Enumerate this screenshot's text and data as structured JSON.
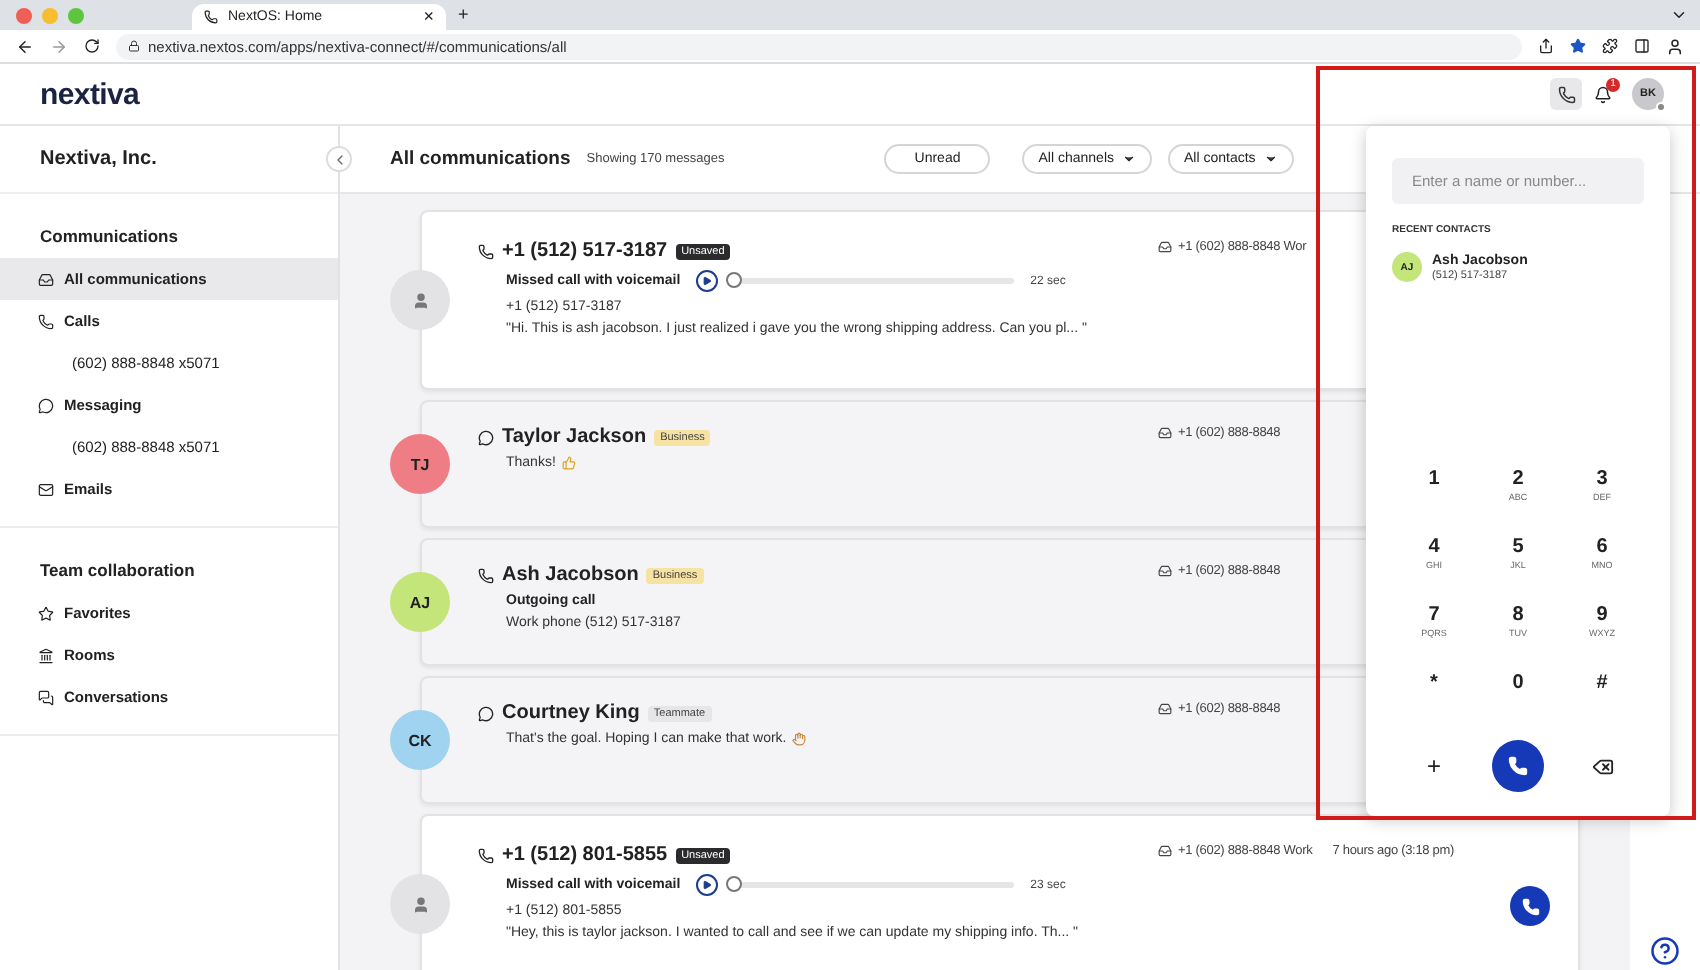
{
  "browser": {
    "tab_title": "NextOS: Home",
    "tab_close": "×",
    "new_tab": "+",
    "url": "nextiva.nextos.com/apps/nextiva-connect/#/communications/all"
  },
  "app_header": {
    "logo": "nextiva",
    "dialer_active": true,
    "notification_count": "1",
    "user_initials": "BK"
  },
  "sidebar": {
    "org": "Nextiva, Inc.",
    "sections": [
      {
        "title": "Communications",
        "items": [
          {
            "label": "All communications",
            "kind": "inbox",
            "selected": true
          },
          {
            "label": "Calls",
            "kind": "phone",
            "selected": false,
            "children": [
              {
                "label": "(602) 888-8848 x5071",
                "selected": false
              }
            ]
          },
          {
            "label": "Messaging",
            "kind": "chat",
            "selected": false,
            "children": [
              {
                "label": "(602) 888-8848 x5071",
                "selected": false
              }
            ]
          },
          {
            "label": "Emails",
            "kind": "mail",
            "selected": false
          }
        ]
      },
      {
        "title": "Team collaboration",
        "items": [
          {
            "label": "Favorites",
            "kind": "star",
            "selected": false
          },
          {
            "label": "Rooms",
            "kind": "building",
            "selected": false
          },
          {
            "label": "Conversations",
            "kind": "chats",
            "selected": false
          }
        ]
      }
    ]
  },
  "main": {
    "title": "All communications",
    "count": "Showing 170 messages",
    "filters": [
      {
        "label": "Unread",
        "kind": "toggle"
      },
      {
        "label": "All channels",
        "kind": "dropdown"
      },
      {
        "label": "All contacts",
        "kind": "dropdown"
      }
    ],
    "cards": [
      {
        "kind": "call",
        "unread": true,
        "avatar": {
          "kind": "unknown"
        },
        "name": "+1 (512) 517-3187",
        "tag": {
          "label": "Unsaved",
          "kind": "dark"
        },
        "summary": "Missed call with voicemail",
        "voicemail": {
          "duration": "22 sec",
          "level": 0
        },
        "lines": [
          {
            "text": "+1 (512) 517-3187"
          },
          {
            "text": "\"Hi. This is ash jacobson. I just realized i gave you the wrong shipping address. Can you pl... \""
          }
        ],
        "line_info": "+1 (602) 888-8848 Wor"
      },
      {
        "kind": "message",
        "unread": false,
        "avatar": {
          "kind": "initials",
          "initials": "TJ",
          "color": "#ef7d86"
        },
        "name": "Taylor Jackson",
        "tag": {
          "label": "Business",
          "kind": "yellow"
        },
        "lines": [
          {
            "text": "Thanks!",
            "emoji": true
          }
        ],
        "line_info": "+1 (602) 888-8848"
      },
      {
        "kind": "call",
        "unread": false,
        "avatar": {
          "kind": "initials",
          "initials": "AJ",
          "color": "#c3e57a"
        },
        "name": "Ash Jacobson",
        "tag": {
          "label": "Business",
          "kind": "yellow"
        },
        "summary": "Outgoing call",
        "lines": [
          {
            "text": "Work phone (512) 517-3187"
          }
        ],
        "line_info": "+1 (602) 888-8848"
      },
      {
        "kind": "message",
        "unread": false,
        "avatar": {
          "kind": "initials",
          "initials": "CK",
          "color": "#9fd3ef"
        },
        "name": "Courtney King",
        "tag": {
          "label": "Teammate",
          "kind": "grey"
        },
        "lines": [
          {
            "text": "That's the goal. Hoping I can make that work.",
            "emoji": true
          }
        ],
        "line_info": "+1 (602) 888-8848"
      },
      {
        "kind": "call",
        "unread": true,
        "avatar": {
          "kind": "unknown"
        },
        "name": "+1 (512) 801-5855",
        "tag": {
          "label": "Unsaved",
          "kind": "dark"
        },
        "summary": "Missed call with voicemail",
        "voicemail": {
          "duration": "23 sec",
          "level": 0
        },
        "lines": [
          {
            "text": "+1 (512) 801-5855"
          },
          {
            "text": "\"Hey, this is taylor jackson. I wanted to call and see if we can update my shipping info. Th... \""
          }
        ],
        "line_info": "+1 (602) 888-8848 Work",
        "time": "7 hours ago (3:18 pm)",
        "call_button": true
      }
    ]
  },
  "dialer": {
    "placeholder": "Enter a name or number...",
    "recent_title": "RECENT CONTACTS",
    "recent": [
      {
        "initials": "AJ",
        "name": "Ash Jacobson",
        "number": "(512) 517-3187",
        "color": "#c3e57a"
      }
    ],
    "keys": [
      {
        "digit": "1"
      },
      {
        "digit": "2",
        "letters": "ABC"
      },
      {
        "digit": "3",
        "letters": "DEF"
      },
      {
        "digit": "4",
        "letters": "GHI"
      },
      {
        "digit": "5",
        "letters": "JKL"
      },
      {
        "digit": "6",
        "letters": "MNO"
      },
      {
        "digit": "7",
        "letters": "PQRS"
      },
      {
        "digit": "8",
        "letters": "TUV"
      },
      {
        "digit": "9",
        "letters": "WXYZ"
      },
      {
        "digit": "*"
      },
      {
        "digit": "0"
      },
      {
        "digit": "#"
      }
    ],
    "actions": [
      {
        "kind": "text",
        "label": "+"
      },
      {
        "kind": "call"
      },
      {
        "kind": "backspace"
      }
    ]
  }
}
